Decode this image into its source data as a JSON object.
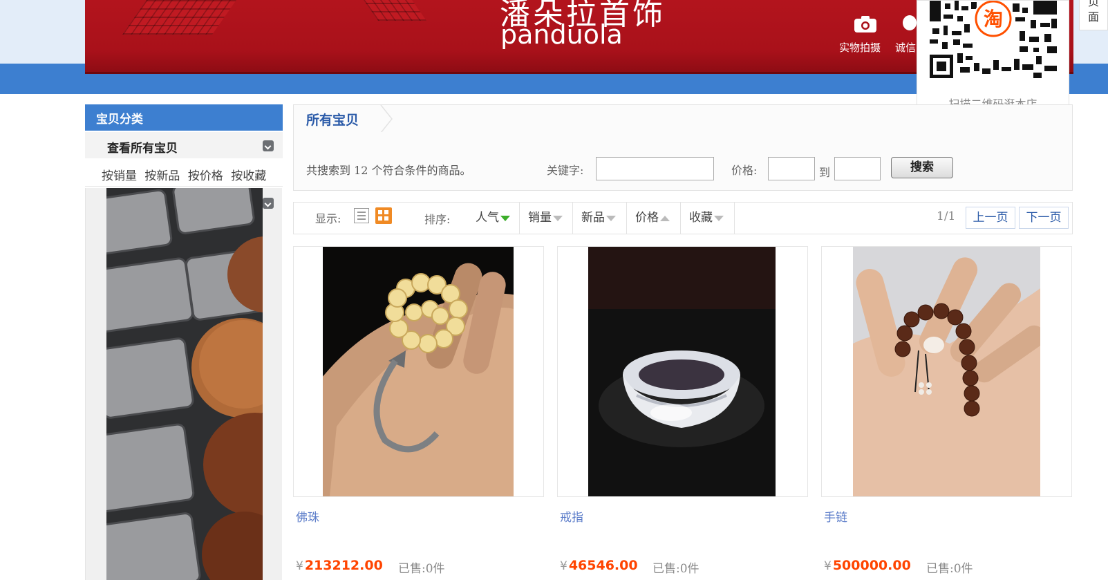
{
  "banner": {
    "brand_cn": "潘朵拉首饰",
    "brand_en": "panduola",
    "photo_label": "实物拍摄",
    "honest_label": "诚信"
  },
  "qr": {
    "badge": "淘",
    "caption": "扫描二维码逛本店"
  },
  "side_tab": {
    "line1": "页",
    "line2": "面"
  },
  "sidebar": {
    "header": "宝贝分类",
    "view_all": "查看所有宝贝",
    "sort_links": [
      "按销量",
      "按新品",
      "按价格",
      "按收藏"
    ]
  },
  "main": {
    "tab_title": "所有宝贝",
    "result_text": "共搜索到 12 个符合条件的商品。",
    "keyword_label": "关键字:",
    "keyword_value": "",
    "price_label": "价格:",
    "price_min": "",
    "to_label": "到",
    "price_max": "",
    "search_button": "搜索"
  },
  "toolbar": {
    "show_label": "显示:",
    "sort_label": "排序:",
    "sort_options": [
      "人气",
      "销量",
      "新品",
      "价格",
      "收藏"
    ],
    "page_indicator": "1/1",
    "prev_button": "上一页",
    "next_button": "下一页"
  },
  "products": [
    {
      "title": "佛珠",
      "currency": "¥",
      "price": "213212.00",
      "sold": "已售:0件"
    },
    {
      "title": "戒指",
      "currency": "¥",
      "price": "46546.00",
      "sold": "已售:0件"
    },
    {
      "title": "手链",
      "currency": "¥",
      "price": "500000.00",
      "sold": "已售:0件"
    }
  ],
  "colors": {
    "brand_red": "#a9111a",
    "header_blue": "#3d7fd0",
    "price_orange": "#ff4400",
    "link_blue": "#5b7cc9",
    "grid_orange": "#f08a24"
  },
  "icons": [
    "camera-icon",
    "qr-code-icon",
    "chevron-down-icon",
    "list-view-icon",
    "grid-view-icon",
    "sort-arrow-icon"
  ]
}
